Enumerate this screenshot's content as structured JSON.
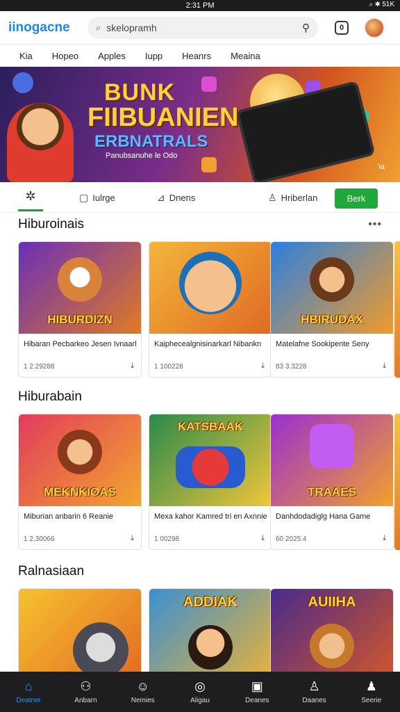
{
  "status": {
    "time": "2:31 PM",
    "right": "⌕ ✱ 51K"
  },
  "header": {
    "logo": "iinogacne",
    "search_placeholder": "skelopramh"
  },
  "topnav": [
    "Kia",
    "Hopeo",
    "Apples",
    "Iupp",
    "Heanrs",
    "Meaina"
  ],
  "banner": {
    "title1": "BUNK",
    "title2": "FIIBUANIEN",
    "title3": "ERBNATRALS",
    "subtitle": "Panubsanuhe le Odo",
    "indicator": "\\a"
  },
  "tabs": {
    "items": [
      "Iulrge",
      "Dnens",
      "Hriberlan"
    ],
    "action": "Berk"
  },
  "sections": [
    {
      "title": "Hiburoinais",
      "cards": [
        {
          "thumb_label": "HIBURDIZN",
          "name": "Hibaran Pecbarkeo Jesen Ivnaarl",
          "meta": "1 2.29288",
          "theme": [
            "#6a2fb8",
            "#e07a24"
          ]
        },
        {
          "thumb_label": "",
          "name": "Kaiphecealgnisinarkarl Nibankn",
          "meta": "1 100228",
          "theme": [
            "#f3b63b",
            "#e06a22"
          ]
        },
        {
          "thumb_label": "HBIRUDAX",
          "name": "Matelafne Sookipente Seny",
          "meta": "83 3.3228",
          "theme": [
            "#2c7fe0",
            "#f29b2a"
          ]
        }
      ]
    },
    {
      "title": "Hiburabain",
      "cards": [
        {
          "thumb_label": "MEKNKIOAS",
          "name": "Miburian anbarin 6 Reanie",
          "meta": "1 2.30066",
          "theme": [
            "#e23c5c",
            "#f2a52e"
          ]
        },
        {
          "thumb_label": "KATSBAAK",
          "name": "Mexa kahor Kamred tri en Axnnie",
          "meta": "1 00298",
          "theme": [
            "#2a8a4a",
            "#f0c63a"
          ]
        },
        {
          "thumb_label": "TRAAES",
          "name": "Danhdodadiglg Hana Game",
          "meta": "60 2025.4",
          "theme": [
            "#9a2fd0",
            "#f2a02a"
          ]
        }
      ]
    },
    {
      "title": "Ralnasiaan",
      "cards": [
        {
          "thumb_label": "",
          "theme": [
            "#f5c22e",
            "#e46a22"
          ]
        },
        {
          "thumb_label": "ADDIAK",
          "theme": [
            "#3b8fd0",
            "#e8b23a"
          ]
        },
        {
          "thumb_label": "AUIIHA",
          "theme": [
            "#4a2a8a",
            "#d2562a"
          ]
        }
      ]
    }
  ],
  "bottom_nav": [
    "Deatner",
    "Anbarn",
    "Nemies",
    "Aligau",
    "Deanes",
    "Daanes",
    "Seerie"
  ]
}
